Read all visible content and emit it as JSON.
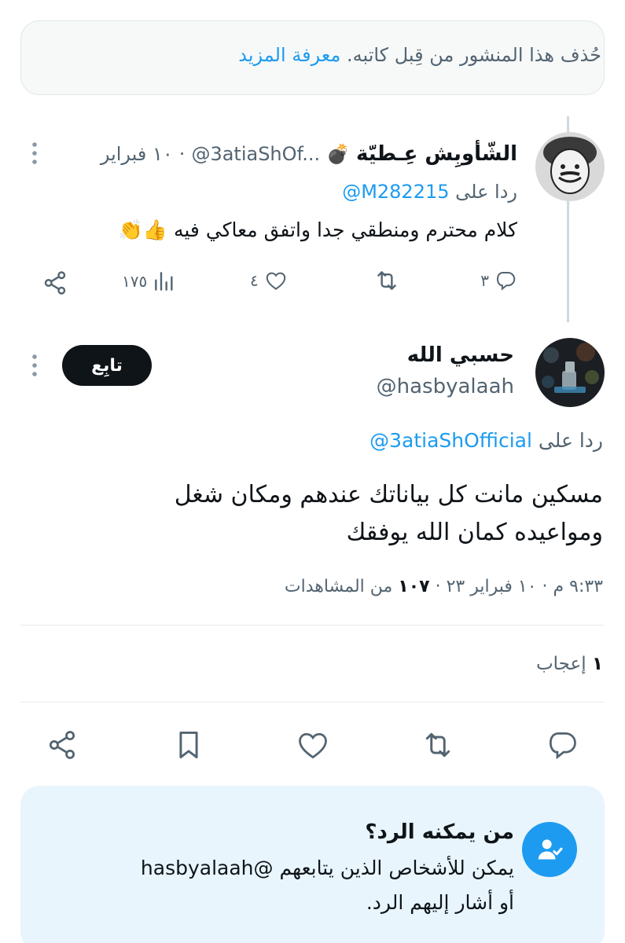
{
  "deleted_notice": {
    "text": "حُذف هذا المنشور من قِبل كاتبه.",
    "link": "معرفة المزيد"
  },
  "reply_tweet": {
    "display_name": "الشّأوبِش عِـطيّة",
    "name_emoji": "💣",
    "handle": "@3atiaShOf...",
    "date": "١٠ فبراير",
    "replying_label": "ردا على",
    "replying_to": "@M282215",
    "text": "كلام محترم ومنطقي جدا واتفق معاكي فيه 👍👏",
    "counts": {
      "replies": "٣",
      "retweets": "",
      "likes": "٤",
      "views": "١٧٥"
    }
  },
  "main_tweet": {
    "display_name": "حسبي الله",
    "handle": "@hasbyalaah",
    "follow_label": "تابِع",
    "replying_label": "ردا على",
    "replying_to": "@3atiaShOfficial",
    "text": "مسكين مانت كل بياناتك عندهم ومكان شغل ومواعيده كمان الله يوفقك",
    "meta_time": "٩:٣٣ م · ١٠ فبراير ٢٣ ·",
    "meta_views_count": "١٠٧",
    "meta_views_label": "من المشاهدات",
    "likes_count": "١",
    "likes_label": "إعجاب"
  },
  "who_can_reply": {
    "title": "من يمكنه الرد؟",
    "line1": "يمكن للأشخاص الذين يتابعهم @hasbyalaah",
    "line2": "أو أشار إليهم الرد."
  },
  "icons": {
    "reply": "reply-icon",
    "retweet": "retweet-icon",
    "like": "heart-icon",
    "views": "views-icon",
    "share": "share-icon",
    "bookmark": "bookmark-icon",
    "more": "more-icon",
    "mention": "mention-person-icon"
  },
  "colors": {
    "accent": "#1d9bf0",
    "text": "#0f1419",
    "muted": "#536471",
    "follow_bg": "#0f1419"
  }
}
